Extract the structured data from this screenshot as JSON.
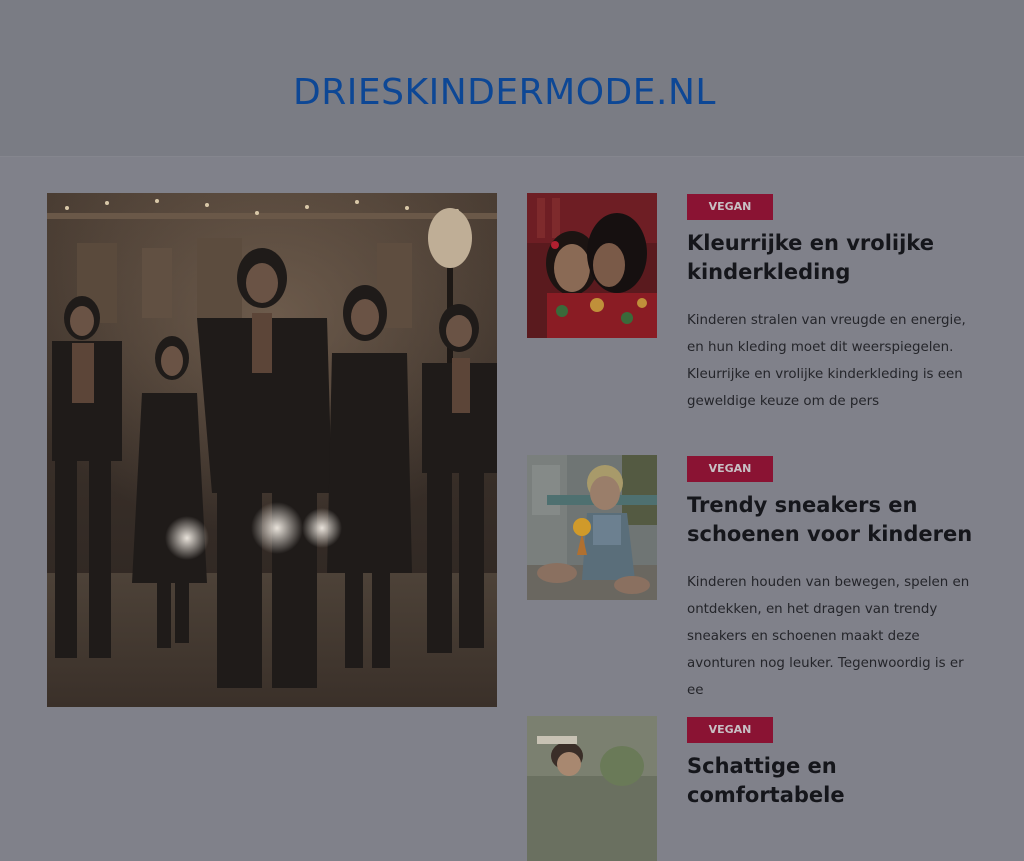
{
  "site": {
    "title": "DRIESKINDERMODE.NL"
  },
  "hero": {
    "image": "people-walking-night-street-photo"
  },
  "posts": [
    {
      "category": "VEGAN",
      "title": "Kleurrijke en vrolijke kinderkleding",
      "excerpt": "Kinderen stralen van vreugde en energie, en hun kleding moet dit weerspiegelen. Kleurrijke en vrolijke kinderkleding is een geweldige keuze om de pers",
      "image": "two-girls-red-floral-photo"
    },
    {
      "category": "VEGAN",
      "title": "Trendy sneakers en schoenen voor kinderen",
      "excerpt": "Kinderen houden van bewegen, spelen en ontdekken, en het dragen van trendy sneakers en schoenen maakt deze avonturen nog leuker. Tegenwoordig is er ee",
      "image": "child-with-ice-cream-photo"
    },
    {
      "category": "VEGAN",
      "title": "Schattige en comfortabele",
      "image": "baby-outdoor-photo"
    }
  ],
  "colors": {
    "background": "#80818a",
    "header": "#7a7c84",
    "title": "#0d4795",
    "badge": "#8a1333",
    "text": "#15161b"
  }
}
